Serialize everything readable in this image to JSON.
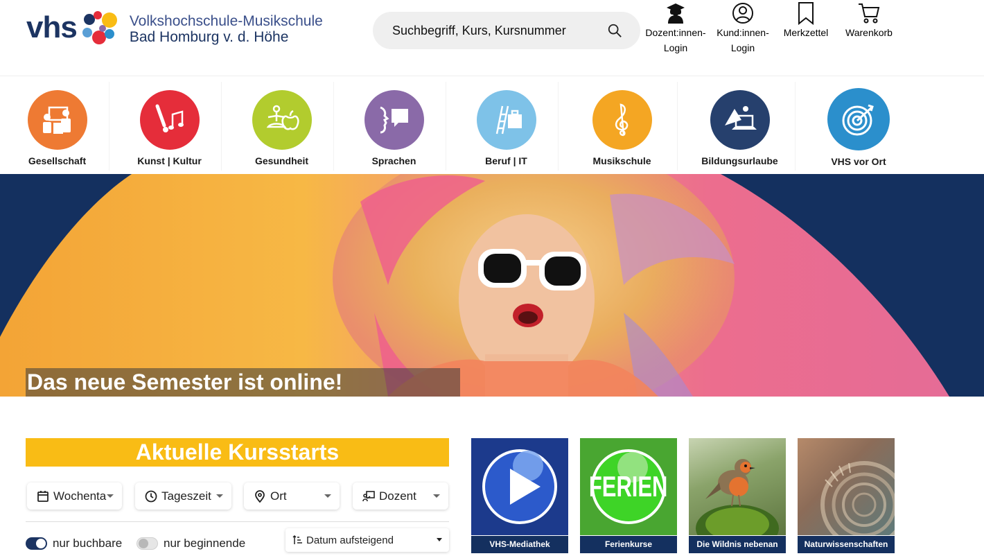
{
  "header": {
    "logo_mark": "vhs",
    "logo_line1": "Volkshochschule-Musikschule",
    "logo_line2": "Bad Homburg v. d. Höhe",
    "search_placeholder": "Suchbegriff, Kurs, Kursnummer",
    "links": [
      {
        "label_line1": "Dozent:innen-",
        "label_line2": "Login",
        "icon": "graduate-icon"
      },
      {
        "label_line1": "Kund:innen-",
        "label_line2": "Login",
        "icon": "user-circle-icon"
      },
      {
        "label_line1": "Merkzettel",
        "label_line2": "",
        "icon": "bookmark-icon"
      },
      {
        "label_line1": "Warenkorb",
        "label_line2": "",
        "icon": "cart-icon"
      }
    ]
  },
  "categories": [
    {
      "label": "Gesellschaft",
      "color": "#ee7a33",
      "icon": "people-board-icon"
    },
    {
      "label": "Kunst | Kultur",
      "color": "#e52d3a",
      "icon": "brush-music-icon"
    },
    {
      "label": "Gesundheit",
      "color": "#b2cc2e",
      "icon": "yoga-apple-icon"
    },
    {
      "label": "Sprachen",
      "color": "#8a6aa8",
      "icon": "speech-face-icon"
    },
    {
      "label": "Beruf | IT",
      "color": "#7ec2e8",
      "icon": "ladder-briefcase-icon"
    },
    {
      "label": "Musikschule",
      "color": "#f4a623",
      "icon": "treble-clef-icon"
    },
    {
      "label": "Bildungsurlaube",
      "color": "#26406d",
      "icon": "mountain-laptop-icon"
    },
    {
      "label": "VHS vor Ort",
      "color": "#2b8fcc",
      "icon": "target-icon"
    }
  ],
  "hero": {
    "caption": "Das neue Semester ist online!"
  },
  "kursstarts": {
    "title": "Aktuelle Kursstarts",
    "filters": [
      {
        "label": "Wochenta",
        "icon": "calendar-icon"
      },
      {
        "label": "Tageszeit",
        "icon": "clock-icon"
      },
      {
        "label": "Ort",
        "icon": "map-pin-icon"
      },
      {
        "label": "Dozent",
        "icon": "teacher-icon"
      }
    ],
    "toggle_bookable": {
      "label": "nur buchbare",
      "on": true
    },
    "toggle_starting": {
      "label": "nur beginnende",
      "on": false
    },
    "sort_label": "Datum aufsteigend"
  },
  "tiles": [
    {
      "caption": "VHS-Mediathek",
      "icon": "play-icon"
    },
    {
      "caption": "Ferienkurse",
      "badge_text": "FERIEN",
      "icon": "ferien-badge-icon"
    },
    {
      "caption": "Die Wildnis nebenan",
      "icon": "robin-bird-icon"
    },
    {
      "caption": "Naturwissenschaften",
      "icon": "ammonite-fossil-icon"
    }
  ],
  "colors": {
    "brand_navy": "#1c3462",
    "accent_yellow": "#f9bc15",
    "hero_bg": "#14305f",
    "toggle_on": "#1c3462"
  }
}
